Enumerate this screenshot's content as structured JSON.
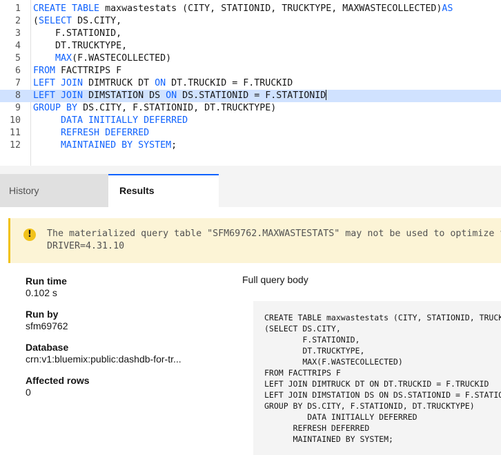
{
  "editor": {
    "lines": [
      {
        "n": "1",
        "parts": [
          {
            "t": "CREATE TABLE ",
            "k": true
          },
          {
            "t": "maxwastestats (CITY, STATIONID, TRUCKTYPE, MAXWASTECOLLECTED)",
            "k": false
          },
          {
            "t": "AS",
            "k": true
          }
        ]
      },
      {
        "n": "2",
        "parts": [
          {
            "t": "(",
            "k": false
          },
          {
            "t": "SELECT ",
            "k": true
          },
          {
            "t": "DS.CITY,",
            "k": false
          }
        ]
      },
      {
        "n": "3",
        "parts": [
          {
            "t": "    F.STATIONID,",
            "k": false
          }
        ]
      },
      {
        "n": "4",
        "parts": [
          {
            "t": "    DT.TRUCKTYPE,",
            "k": false
          }
        ]
      },
      {
        "n": "5",
        "parts": [
          {
            "t": "    ",
            "k": false
          },
          {
            "t": "MAX",
            "k": true
          },
          {
            "t": "(F.WASTECOLLECTED)",
            "k": false
          }
        ]
      },
      {
        "n": "6",
        "parts": [
          {
            "t": "FROM ",
            "k": true
          },
          {
            "t": "FACTTRIPS F",
            "k": false
          }
        ]
      },
      {
        "n": "7",
        "parts": [
          {
            "t": "LEFT JOIN ",
            "k": true
          },
          {
            "t": "DIMTRUCK DT ",
            "k": false
          },
          {
            "t": "ON ",
            "k": true
          },
          {
            "t": "DT.TRUCKID = F.TRUCKID",
            "k": false
          }
        ]
      },
      {
        "n": "8",
        "parts": [
          {
            "t": "LEFT JOIN ",
            "k": true
          },
          {
            "t": "DIMSTATION DS ",
            "k": false
          },
          {
            "t": "ON ",
            "k": true
          },
          {
            "t": "DS.STATIONID = F.STATIONID",
            "k": false
          }
        ]
      },
      {
        "n": "9",
        "parts": [
          {
            "t": "GROUP BY ",
            "k": true
          },
          {
            "t": "DS.CITY, F.STATIONID, DT.TRUCKTYPE)",
            "k": false
          }
        ]
      },
      {
        "n": "10",
        "parts": [
          {
            "t": "     DATA INITIALLY DEFERRED",
            "k": true
          }
        ]
      },
      {
        "n": "11",
        "parts": [
          {
            "t": "     REFRESH DEFERRED",
            "k": true
          }
        ]
      },
      {
        "n": "12",
        "parts": [
          {
            "t": "     MAINTAINED BY SYSTEM",
            "k": true
          },
          {
            "t": ";",
            "k": false
          }
        ]
      }
    ],
    "active_line": 8
  },
  "tabs": {
    "history": "History",
    "results": "Results"
  },
  "warning": {
    "icon": "!",
    "line1": "The materialized query table \"SFM69762.MAXWASTESTATS\" may not be used to optimize the processing of queries.",
    "line2": "DRIVER=4.31.10"
  },
  "details": {
    "run_time_label": "Run time",
    "run_time_value": "0.102 s",
    "run_by_label": "Run by",
    "run_by_value": "sfm69762",
    "database_label": "Database",
    "database_value": "crn:v1:bluemix:public:dashdb-for-tr...",
    "affected_label": "Affected rows",
    "affected_value": "0"
  },
  "full_query": {
    "title": "Full query body",
    "text": "CREATE TABLE maxwastestats (CITY, STATIONID, TRUCKTYPE, MAXWASTECOLLECTED)AS\n(SELECT DS.CITY,\n        F.STATIONID,\n        DT.TRUCKTYPE,\n        MAX(F.WASTECOLLECTED)\nFROM FACTTRIPS F\nLEFT JOIN DIMTRUCK DT ON DT.TRUCKID = F.TRUCKID\nLEFT JOIN DIMSTATION DS ON DS.STATIONID = F.STATIONID\nGROUP BY DS.CITY, F.STATIONID, DT.TRUCKTYPE)\n         DATA INITIALLY DEFERRED\n      REFRESH DEFERRED\n      MAINTAINED BY SYSTEM;"
  },
  "colors": {
    "keyword": "#0f62fe",
    "active_line": "#d0e2ff",
    "warning_bg": "#fcf4d6",
    "warning_accent": "#f1c21b"
  }
}
